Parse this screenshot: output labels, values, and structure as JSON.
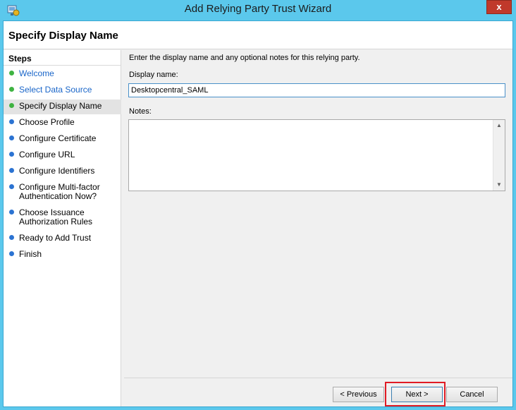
{
  "window": {
    "title": "Add Relying Party Trust Wizard",
    "close_glyph": "x",
    "accent_color": "#5bc8ec"
  },
  "header": {
    "page_title": "Specify Display Name"
  },
  "steps": {
    "heading": "Steps",
    "items": [
      {
        "label": "Welcome",
        "status": "done",
        "link": true
      },
      {
        "label": "Select Data Source",
        "status": "done",
        "link": true
      },
      {
        "label": "Specify Display Name",
        "status": "current",
        "link": false
      },
      {
        "label": "Choose Profile",
        "status": "todo",
        "link": false
      },
      {
        "label": "Configure Certificate",
        "status": "todo",
        "link": false
      },
      {
        "label": "Configure URL",
        "status": "todo",
        "link": false
      },
      {
        "label": "Configure Identifiers",
        "status": "todo",
        "link": false
      },
      {
        "label": "Configure Multi-factor Authentication Now?",
        "status": "todo",
        "link": false
      },
      {
        "label": "Choose Issuance Authorization Rules",
        "status": "todo",
        "link": false
      },
      {
        "label": "Ready to Add Trust",
        "status": "todo",
        "link": false
      },
      {
        "label": "Finish",
        "status": "todo",
        "link": false
      }
    ]
  },
  "content": {
    "intro": "Enter the display name and any optional notes for this relying party.",
    "display_name_label": "Display name:",
    "display_name_value": "Desktopcentral_SAML",
    "notes_label": "Notes:",
    "notes_value": ""
  },
  "buttons": {
    "previous": "< Previous",
    "next": "Next >",
    "cancel": "Cancel"
  }
}
